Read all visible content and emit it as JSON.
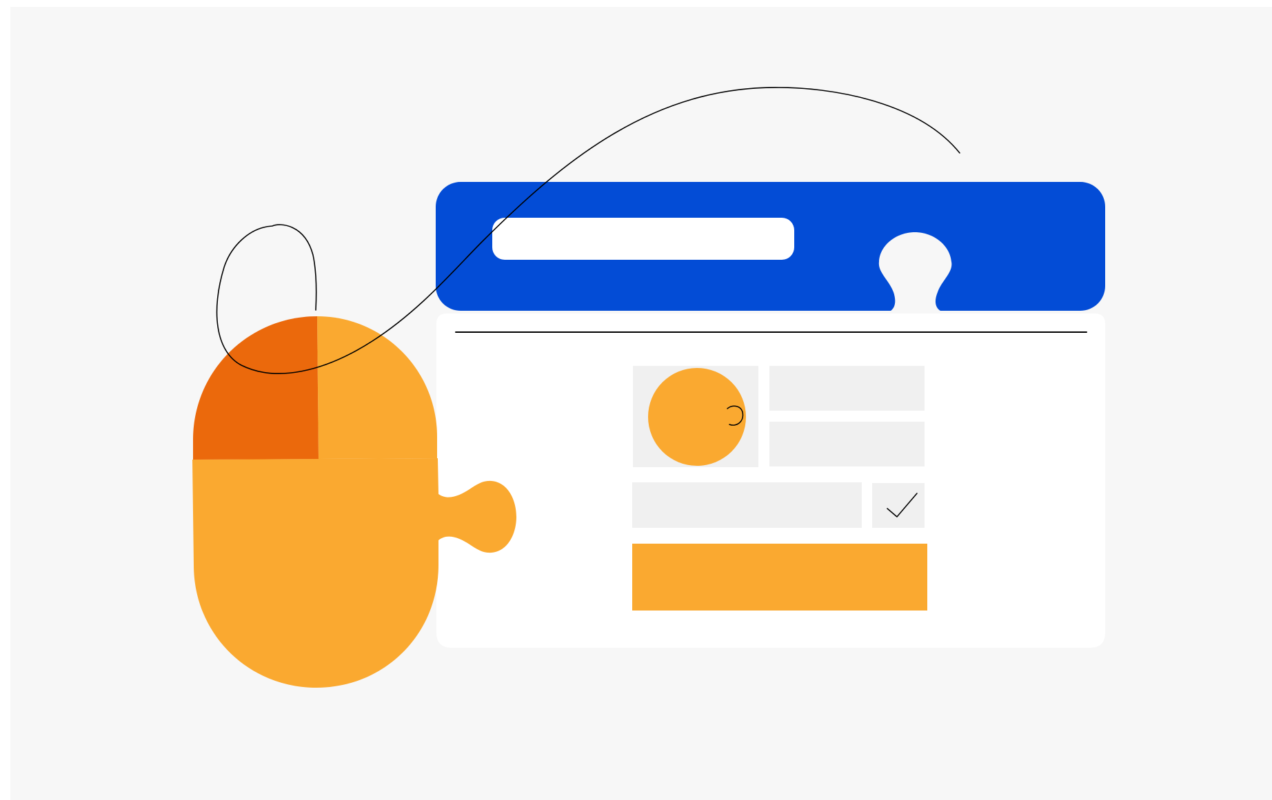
{
  "illustration": {
    "subject": "",
    "colors": {
      "canvas_background": "#ffffff",
      "panel_background": "#f7f7f7",
      "window_header": "#034cd6",
      "window_body": "#ffffff",
      "search_bar": "#ffffff",
      "placeholder_block": "#f0f0f0",
      "accent_orange": "#faa930",
      "accent_dark_orange": "#eb690c",
      "line": "#000000"
    },
    "icons": [
      "mouse-icon",
      "puzzle-piece-icon",
      "browser-window-icon",
      "search-bar-icon",
      "avatar-icon",
      "checkbox-icon",
      "checkmark-icon",
      "mouse-cable-icon"
    ],
    "form": {
      "checkbox_checked": true
    }
  }
}
